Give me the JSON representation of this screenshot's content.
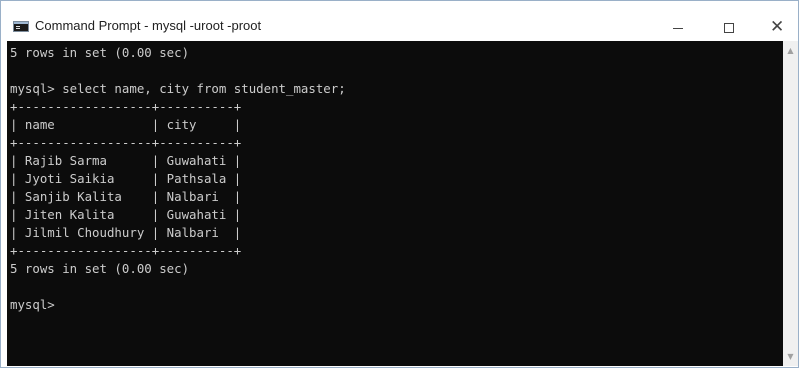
{
  "window": {
    "title": "Command Prompt - mysql  -uroot -proot",
    "icon": "cmd-icon",
    "controls": {
      "minimize_icon": "minimize-icon",
      "maximize_icon": "maximize-icon",
      "close_icon": "close-icon",
      "close_glyph": "✕"
    }
  },
  "console": {
    "lines": [
      "5 rows in set (0.00 sec)",
      "",
      "mysql> select name, city from student_master;",
      "+------------------+----------+",
      "| name             | city     |",
      "+------------------+----------+",
      "| Rajib Sarma      | Guwahati |",
      "| Jyoti Saikia     | Pathsala |",
      "| Sanjib Kalita    | Nalbari  |",
      "| Jiten Kalita     | Guwahati |",
      "| Jilmil Choudhury | Nalbari  |",
      "+------------------+----------+",
      "5 rows in set (0.00 sec)",
      "",
      "mysql>"
    ],
    "text_color": "#cccccc",
    "background": "#0c0c0c"
  },
  "scrollbar": {
    "up_glyph": "▲",
    "down_glyph": "▼"
  }
}
